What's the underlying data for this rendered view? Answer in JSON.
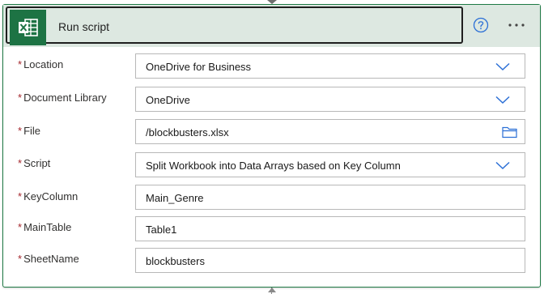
{
  "action": {
    "title": "Run script",
    "app_icon": "excel-icon",
    "help_icon": "help-circle-icon",
    "more_icon": "more-ellipsis-icon"
  },
  "colors": {
    "header_bg": "#dde8e1",
    "excel_green": "#1d7344",
    "accent_blue": "#2b6fd6",
    "required_red": "#a4262c"
  },
  "fields": [
    {
      "label": "Location",
      "value": "OneDrive for Business",
      "control": "dropdown"
    },
    {
      "label": "Document Library",
      "value": "OneDrive",
      "control": "dropdown"
    },
    {
      "label": "File",
      "value": "/blockbusters.xlsx",
      "control": "file-picker"
    },
    {
      "label": "Script",
      "value": "Split Workbook into Data Arrays based on Key Column",
      "control": "dropdown"
    },
    {
      "label": "KeyColumn",
      "value": "Main_Genre",
      "control": "text"
    },
    {
      "label": "MainTable",
      "value": "Table1",
      "control": "text"
    },
    {
      "label": "SheetName",
      "value": "blockbusters",
      "control": "text"
    }
  ],
  "required_marker": "*"
}
